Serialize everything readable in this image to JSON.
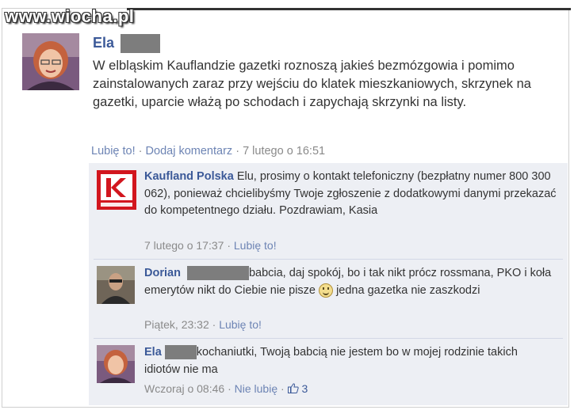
{
  "watermark": "www.wiocha.pl",
  "post": {
    "author": "Ela",
    "text": "W elbląskim Kauflandzie gazetki roznoszą jakieś bezmózgowia i pomimo zainstalowanych zaraz przy wejściu do klatek mieszkaniowych, skrzynek na gazetki, uparcie włażą po schodach i zapychają skrzynki na listy.",
    "like": "Lubię to!",
    "sep": "·",
    "comment": "Dodaj komentarz",
    "time": "7 lutego o 16:51"
  },
  "comments": [
    {
      "author": "Kaufland Polska",
      "text": "Elu, prosimy o kontakt telefoniczny (bezpłatny numer 800 300 062), ponieważ chcielibyśmy Twoje zgłoszenie z dodatkowymi danymi przekazać do kompetentnego działu. Pozdrawiam, Kasia",
      "time": "7 lutego o 17:37",
      "like": "Lubię to!"
    },
    {
      "author": "Dorian",
      "text_before": "babcia, daj spokój, bo i tak nikt prócz rossmana, PKO i koła emerytów nikt do Ciebie nie pisze",
      "text_after": "jedna gazetka nie zaszkodzi",
      "time": "Piątek, 23:32",
      "like": "Lubię to!"
    },
    {
      "author": "Ela",
      "text": "kochaniutki, Twoją babcią nie jestem bo w mojej rodzinie takich idiotów nie ma",
      "time": "Wczoraj o 08:46",
      "unlike": "Nie lubię",
      "likes_count": "3"
    }
  ],
  "colors": {
    "link": "#3b5998",
    "comments_bg": "#edeff4",
    "kaufland_red": "#d2161e"
  }
}
